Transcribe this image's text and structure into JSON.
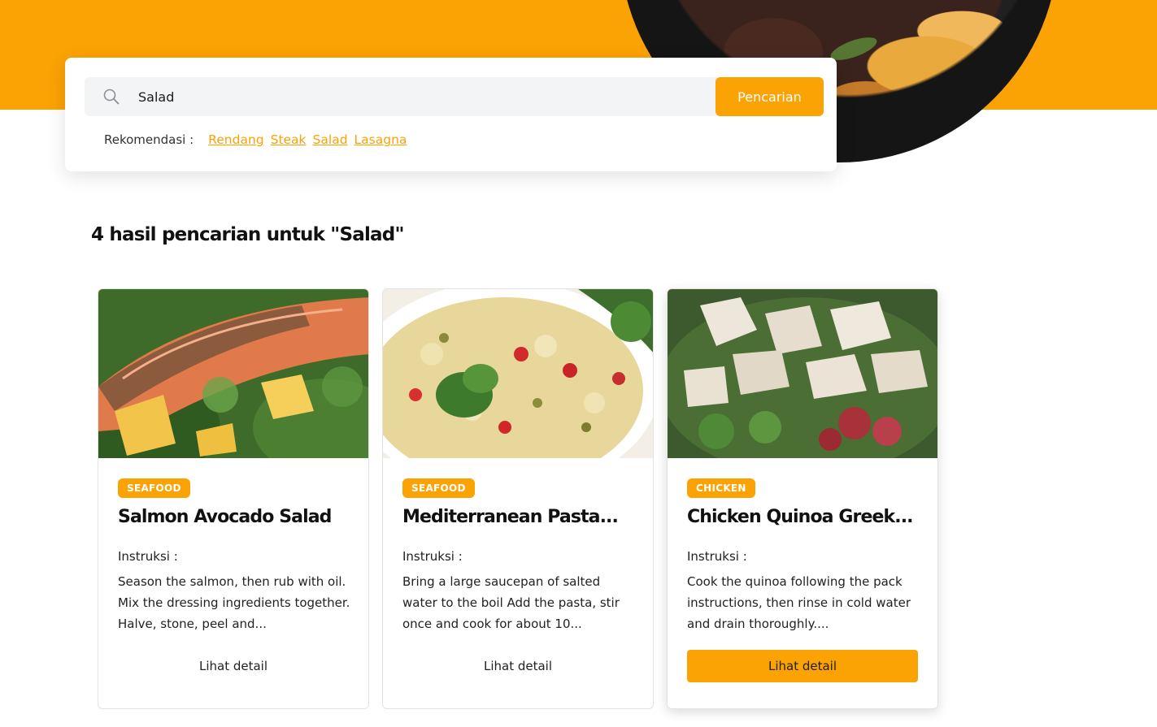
{
  "search": {
    "value": "Salad",
    "button_label": "Pencarian",
    "recommendation_label": "Rekomendasi :",
    "recommendations": [
      "Rendang",
      "Steak",
      "Salad",
      "Lasagna"
    ]
  },
  "results": {
    "title": "4 hasil pencarian untuk \"Salad\""
  },
  "cards": [
    {
      "category": "SEAFOOD",
      "title": "Salmon Avocado Salad",
      "instructions_label": "Instruksi :",
      "instructions": "Season the salmon, then rub with oil. Mix the dressing ingredients together. Halve, stone, peel and...",
      "button_label": "Lihat detail"
    },
    {
      "category": "SEAFOOD",
      "title": "Mediterranean Pasta...",
      "instructions_label": "Instruksi :",
      "instructions": "Bring a large saucepan of salted water to the boil Add the pasta, stir once and cook for about 10...",
      "button_label": "Lihat detail"
    },
    {
      "category": "CHICKEN",
      "title": "Chicken Quinoa Greek...",
      "instructions_label": "Instruksi :",
      "instructions": "Cook the quinoa following the pack instructions, then rinse in cold water and drain thoroughly....",
      "button_label": "Lihat detail"
    }
  ],
  "colors": {
    "accent": "#FBA204",
    "search_bg": "#F3F4F6"
  },
  "icons": {
    "search": "search-icon"
  }
}
